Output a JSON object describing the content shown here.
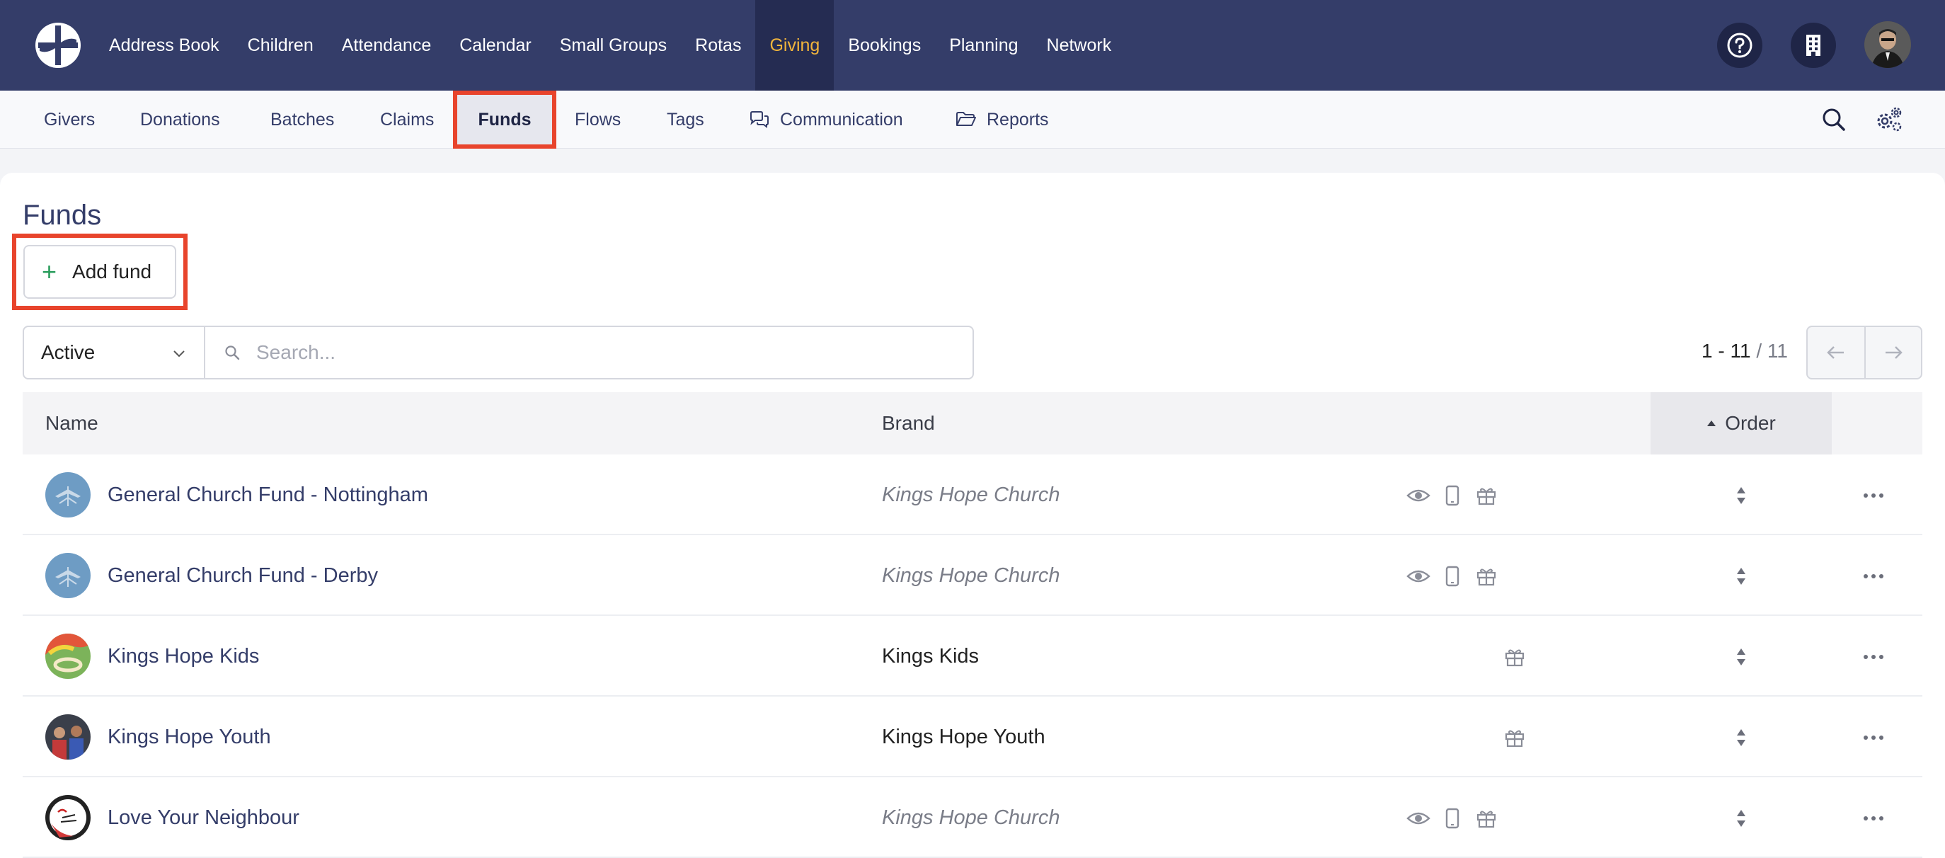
{
  "top_nav": {
    "logo_icon": "church-logo-icon",
    "items": [
      {
        "label": "Address Book"
      },
      {
        "label": "Children"
      },
      {
        "label": "Attendance"
      },
      {
        "label": "Calendar"
      },
      {
        "label": "Small Groups"
      },
      {
        "label": "Rotas"
      },
      {
        "label": "Giving",
        "active": true
      },
      {
        "label": "Bookings"
      },
      {
        "label": "Planning"
      },
      {
        "label": "Network"
      }
    ],
    "active_color": "#f0b43c",
    "background": "#343d69",
    "right_icons": [
      "help-icon",
      "building-icon",
      "user-avatar"
    ]
  },
  "sub_nav": {
    "items": [
      {
        "label": "Givers"
      },
      {
        "label": "Donations"
      },
      {
        "label": "Batches"
      },
      {
        "label": "Claims"
      },
      {
        "label": "Funds",
        "active": true
      },
      {
        "label": "Flows"
      },
      {
        "label": "Tags"
      },
      {
        "label": "Communication",
        "icon": "chat-icon"
      },
      {
        "label": "Reports",
        "icon": "folder-open-icon"
      }
    ],
    "right_icons": [
      "search-icon",
      "settings-gears-icon"
    ]
  },
  "page": {
    "title": "Funds",
    "add_button_label": "Add fund",
    "filter": {
      "selected": "Active"
    },
    "search": {
      "placeholder": "Search..."
    },
    "pager": {
      "range": "1 - 11",
      "total": "/ 11"
    }
  },
  "table": {
    "columns": {
      "name": "Name",
      "brand": "Brand",
      "order": "Order"
    },
    "rows": [
      {
        "name": "General Church Fund - Nottingham",
        "brand": "Kings Hope Church",
        "brand_inherited": true,
        "icons": [
          "eye-icon",
          "mobile-icon",
          "gift-icon"
        ],
        "avatar": "kings-hope-logo"
      },
      {
        "name": "General Church Fund - Derby",
        "brand": "Kings Hope Church",
        "brand_inherited": true,
        "icons": [
          "eye-icon",
          "mobile-icon",
          "gift-icon"
        ],
        "avatar": "kings-hope-logo"
      },
      {
        "name": "Kings Hope Kids",
        "brand": "Kings Kids",
        "brand_inherited": false,
        "icons": [
          "gift-icon"
        ],
        "avatar": "kids-photo"
      },
      {
        "name": "Kings Hope Youth",
        "brand": "Kings Hope Youth",
        "brand_inherited": false,
        "icons": [
          "gift-icon"
        ],
        "avatar": "youth-photo"
      },
      {
        "name": "Love Your Neighbour",
        "brand": "Kings Hope Church",
        "brand_inherited": true,
        "icons": [
          "eye-icon",
          "mobile-icon",
          "gift-icon"
        ],
        "avatar": "love-neighbour-logo"
      }
    ]
  }
}
